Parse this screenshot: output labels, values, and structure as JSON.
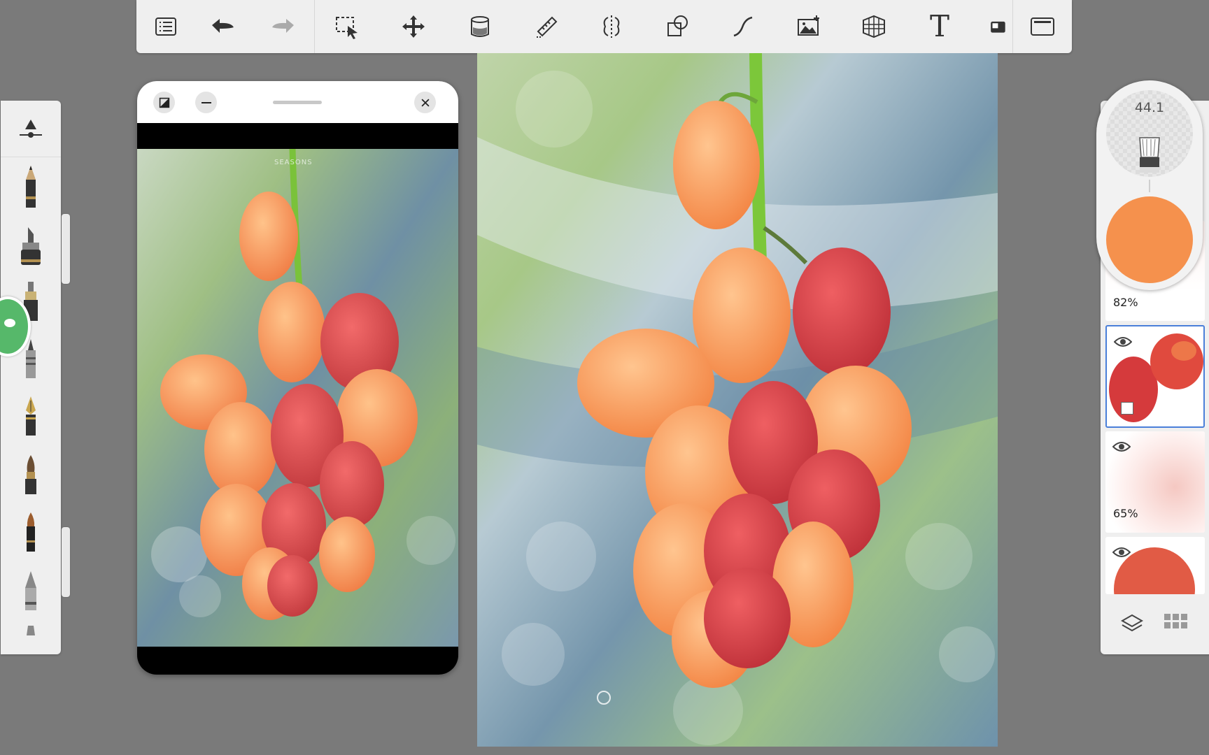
{
  "toolbar": {
    "items": [
      "menu-list",
      "undo",
      "redo",
      "selection",
      "transform",
      "fill",
      "ruler",
      "symmetry",
      "shapes",
      "curve",
      "import-image",
      "perspective",
      "text",
      "layer-preview",
      "fullscreen"
    ],
    "text_tool_glyph": "T"
  },
  "brushes": [
    "airbrush",
    "pencil",
    "marker",
    "inking-pen",
    "technical-pen",
    "fountain-pen",
    "paint-brush",
    "ink-brush",
    "soft-pencil",
    "pastel"
  ],
  "reference_window": {
    "image_caption": "SEASONS",
    "icons": [
      "contrast-icon",
      "minimize-icon",
      "drag-handle",
      "close-icon"
    ]
  },
  "brush_puck": {
    "size": "44.1",
    "color": "#f5914d"
  },
  "layers": [
    {
      "opacity": "82%",
      "visible": true
    },
    {
      "opacity": "",
      "visible": true,
      "selected": true
    },
    {
      "opacity": "65%",
      "visible": true
    },
    {
      "opacity": "",
      "visible": true
    }
  ],
  "layer_footer": [
    "layers-icon",
    "grid-icon"
  ],
  "colors": {
    "background": "#7a7a7a",
    "panel": "#efefef",
    "accent": "#4a7fd9",
    "current_color": "#f5914d"
  }
}
